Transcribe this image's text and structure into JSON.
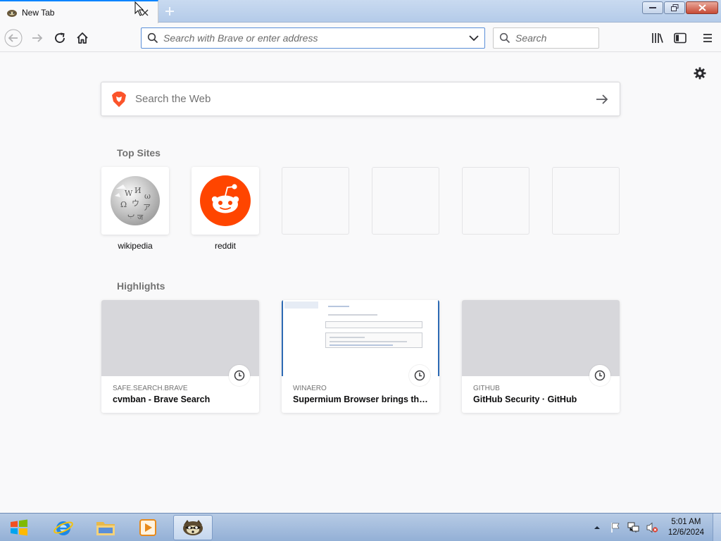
{
  "browser": {
    "tab": {
      "title": "New Tab"
    },
    "urlbar": {
      "placeholder": "Search with Brave or enter address"
    },
    "searchbar": {
      "placeholder": "Search"
    }
  },
  "newtab": {
    "web_search": {
      "placeholder": "Search the Web"
    },
    "top_sites": {
      "title": "Top Sites",
      "items": [
        {
          "label": "wikipedia",
          "icon": "wikipedia-globe-icon"
        },
        {
          "label": "reddit",
          "icon": "reddit-snoo-icon"
        },
        {
          "label": "",
          "icon": ""
        },
        {
          "label": "",
          "icon": ""
        },
        {
          "label": "",
          "icon": ""
        },
        {
          "label": "",
          "icon": ""
        }
      ]
    },
    "highlights": {
      "title": "Highlights",
      "items": [
        {
          "source": "SAFE.SEARCH.BRAVE",
          "title": "cvmban - Brave Search"
        },
        {
          "source": "WINAERO",
          "title": "Supermium Browser brings the ..."
        },
        {
          "source": "GITHUB",
          "title": "GitHub Security · GitHub"
        }
      ]
    }
  },
  "taskbar": {
    "apps": [
      "internet-explorer-icon",
      "file-explorer-icon",
      "media-player-icon",
      "waterfox-browser-icon"
    ],
    "clock": {
      "time": "5:01 AM",
      "date": "12/6/2024"
    }
  },
  "colors": {
    "accent": "#0a84ff",
    "reddit": "#ff4500",
    "brave": "#fb542b"
  }
}
